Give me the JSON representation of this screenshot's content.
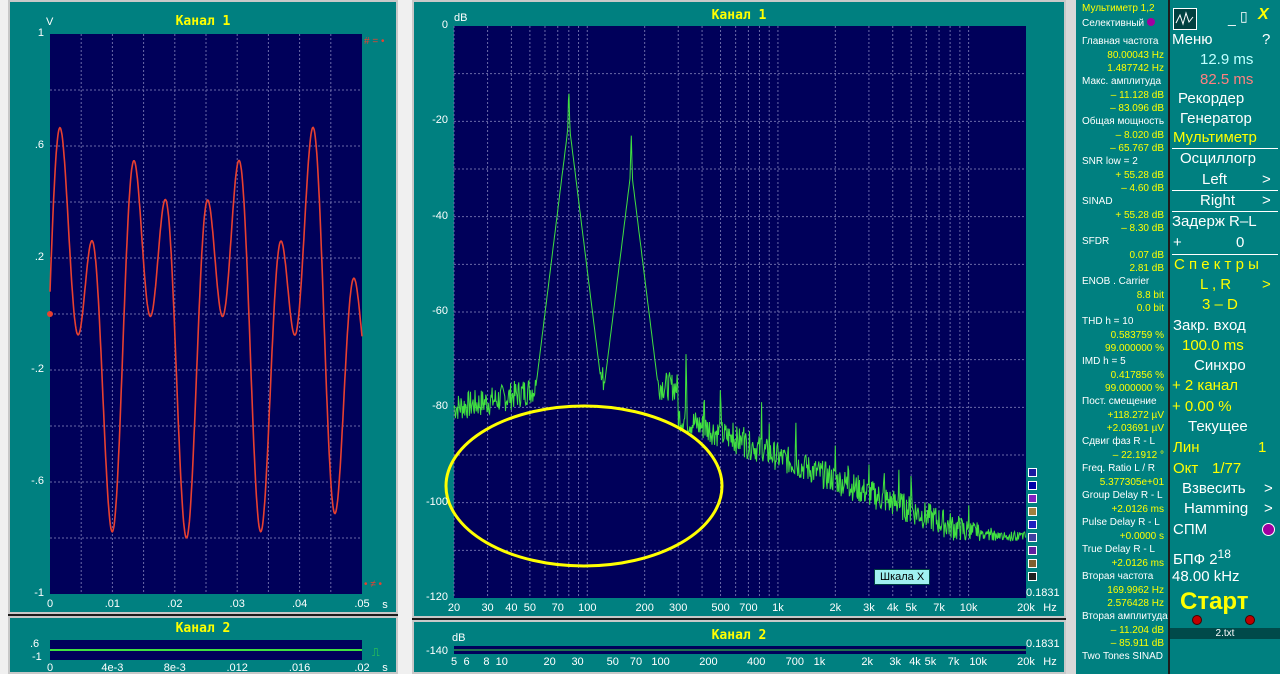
{
  "ch1_left": {
    "title": "Канал 1",
    "ylabel": "V",
    "yticks": [
      "1",
      ".6",
      ".2",
      "-.2",
      "-.6",
      "-1"
    ],
    "xticks": [
      "0",
      ".01",
      ".02",
      ".03",
      ".04",
      ".05"
    ],
    "xunit": "s"
  },
  "ch2_left": {
    "title": "Канал 2",
    "ytick": ".6",
    "ytick2": "-1",
    "xticks": [
      "0",
      "4e-3",
      "8e-3",
      ".012",
      ".016",
      ".02"
    ],
    "xunit": "s"
  },
  "spectrum": {
    "title": "Канал 1",
    "ylabel": "dB",
    "yticks": [
      "0",
      "-20",
      "-40",
      "-60",
      "-80",
      "-100",
      "-120"
    ],
    "xticks": [
      "20",
      "30",
      "40",
      "50",
      "70",
      "100",
      "200",
      "300",
      "500",
      "700",
      "1k",
      "2k",
      "3k",
      "4k",
      "5k",
      "7k",
      "10k",
      "20k"
    ],
    "xunit": "Hz",
    "corner_value": "0.1831",
    "scale_button": "Шкала X"
  },
  "spectrum2": {
    "title": "Канал 2",
    "ylabel": "dB",
    "ytick": "-140",
    "corner_value": "0.1831",
    "xticks": [
      "5",
      "6",
      "8",
      "10",
      "20",
      "30",
      "50",
      "70",
      "100",
      "200",
      "400",
      "700",
      "1k",
      "2k",
      "3k",
      "4k",
      "5k",
      "7k",
      "10k",
      "20k"
    ],
    "xunit": "Hz"
  },
  "multimeter": {
    "title": "Мультиметр 1,2",
    "mode": "Селективный",
    "rows": [
      {
        "label": "Главная частота",
        "v1": "80.00043  Hz",
        "v2": "1.487742  Hz"
      },
      {
        "label": "Макс. амплитуда",
        "v1": "– 11.128 dB",
        "v2": "– 83.096 dB"
      },
      {
        "label": "Общая мощность",
        "v1": "– 8.020 dB",
        "v2": "– 65.767 dB"
      },
      {
        "label": "SNR     low = 2",
        "v1": "+ 55.28 dB",
        "v2": "– 4.60 dB"
      },
      {
        "label": "SINAD",
        "v1": "+ 55.28 dB",
        "v2": "– 8.30 dB"
      },
      {
        "label": "SFDR",
        "v1": "0.07 dB",
        "v2": "2.81 dB"
      },
      {
        "label": "ENOB . Carrier",
        "v1": "8.8 bit",
        "v2": "0.0 bit"
      },
      {
        "label": "THD     h = 10",
        "v1": "0.583759 %",
        "v2": "99.000000 %"
      },
      {
        "label": "IMD     h =  5",
        "v1": "0.417856 %",
        "v2": "99.000000 %"
      },
      {
        "label": "Пост. смещение",
        "v1": "+118.272 µV",
        "v2": "+2.03691 µV"
      },
      {
        "label": "Сдвиг фаз R - L",
        "v1": "– 22.1912 °",
        "v2": ""
      },
      {
        "label": "Freq. Ratio  L / R",
        "v1": "5.377305e+01",
        "v2": ""
      },
      {
        "label": "Group Delay R - L",
        "v1": "+2.0126 ms",
        "v2": ""
      },
      {
        "label": "Pulse Delay R - L",
        "v1": "+0.0000  s",
        "v2": ""
      },
      {
        "label": "True  Delay R - L",
        "v1": "+2.0126 ms",
        "v2": ""
      },
      {
        "label": "Вторая частота",
        "v1": "169.9962  Hz",
        "v2": "2.576428  Hz"
      },
      {
        "label": "Вторая амплитуда",
        "v1": "– 11.204 dB",
        "v2": "– 85.911 dB"
      },
      {
        "label": "Two Tones SINAD",
        "v1": "",
        "v2": ""
      }
    ]
  },
  "sidebar": {
    "menu": "Меню",
    "help": "?",
    "t1": "12.9 ms",
    "t2": "82.5 ms",
    "recorder": "Рекордер",
    "generator": "Генератор",
    "multimeter": "Мультиметр",
    "oscillograph": "Осциллогр",
    "left": "Left",
    "right": "Right",
    "arrow": ">",
    "delay": "Задерж  R–L",
    "delay_sign": "+",
    "delay_val": "0",
    "spectra": "С п е к т р ы",
    "lr": "L , R",
    "threed": "3 – D",
    "lock_input": "Закр.  вход",
    "lock_time": "100.0 ms",
    "sync": "Синхро",
    "sync_ch": "+  2 канал",
    "sync_pct": "+  0.00 %",
    "current": "Текущее",
    "lin": "Лин",
    "lin_val": "1",
    "oct": "Окт",
    "oct_val": "1/77",
    "weigh": "Взвесить",
    "hamming": "Hamming",
    "spm": "СПМ",
    "fft": "БПФ  2",
    "fft_exp": "18",
    "rate": "48.00 kHz",
    "start": "Старт",
    "file": "2.txt"
  },
  "colors": {
    "panel": "#008080",
    "plot": "#00005a",
    "title": "#ffff00",
    "waveform": "#e84030",
    "spectrum": "#40e040",
    "highlight": "#ffff00"
  }
}
